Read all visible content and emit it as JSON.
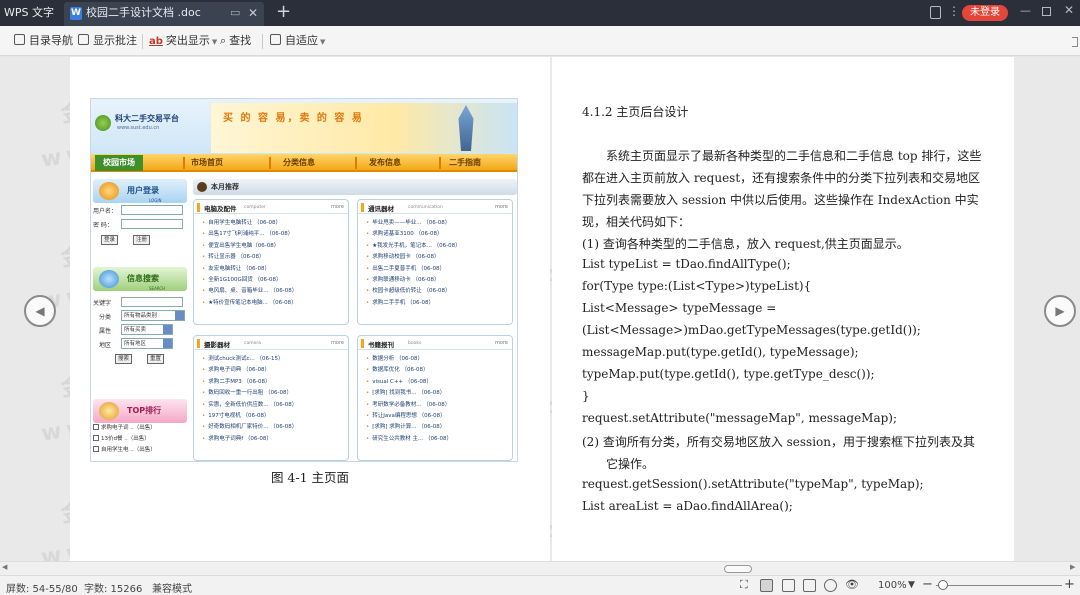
{
  "tabbar": {
    "app_name": "WPS 文字",
    "doc_tab": "校园二手设计文档 .doc",
    "login_label": "未登录"
  },
  "toolbar": {
    "outline_nav": "目录导航",
    "show_comments": "显示批注",
    "highlight": "突出显示",
    "find": "查找",
    "fit": "自适应"
  },
  "website": {
    "logo_name": "科大二手交易平台",
    "logo_url": "www.sust.edu.cn",
    "slogan": "买 的 容 易，卖 的 容 易",
    "nav_home": "校园市场",
    "nav_items": [
      "市场首页",
      "分类信息",
      "发布信息",
      "二手指南"
    ],
    "login_box": {
      "title": "用户登录",
      "sub": "LOGIN",
      "username_label": "用户名：",
      "password_label": "密 码：",
      "login_btn": "登录",
      "register_btn": "注册"
    },
    "search_box": {
      "title": "信息搜索",
      "sub": "SEARCH",
      "keyword_label": "关键字",
      "category_label": "分类",
      "category_value": "所有物品类别",
      "type_label": "属性",
      "type_value": "所有买卖",
      "area_label": "地区",
      "area_value": "所有地区",
      "search_btn": "搜索",
      "reset_btn": "重置"
    },
    "top_box": {
      "title": "TOP排行",
      "items": [
        "求购电子词 ..（出售）",
        "13价d餐 ..（出售）",
        "自用学生电 ..（出售）"
      ]
    },
    "recommend_title": "本月推荐",
    "categories": [
      {
        "name": "电脑及配件",
        "en": "computer",
        "more": "more",
        "items": [
          "自用学生电脑转让 （06-08）",
          "出售17寸飞利浦纯平... （06-08）",
          "便宜出售学生电脑（06-08）",
          "转让显示器 （06-08）",
          "友宏电脑转让 （06-08）",
          "全新1G100G回货 （06-08）",
          "电风扇、桌、音箱毕业... （06-08）",
          "★特价宣传笔记本电脑... （06-08）"
        ]
      },
      {
        "name": "通讯器材",
        "en": "communication",
        "more": "more",
        "items": [
          "毕业甩卖——毕业... （06-08）",
          "求购诺基亚3100 （06-08）",
          "★我发光手机，笔记本... （06-08）",
          "求购移动校园卡 （06-08）",
          "出售二手夏普手机 （06-08）",
          "求购联通移动卡 （06-08）",
          "校园卡超级低价转让 （06-08）",
          "求购二手手机 （06-08）"
        ]
      },
      {
        "name": "摄影器材",
        "en": "camera",
        "more": "more",
        "items": [
          "测试chuck测试c... （06-15）",
          "求购电子词典 （06-08）",
          "求购二手MP3 （06-08）",
          "数码回收一重一行出租 （06-08）",
          "实惠，全新低价供应数... （06-08）",
          "197寸电视机 （06-08）",
          "好奇数码相机厂家特价... （06-08）",
          "求购电子词典f （06-08）"
        ]
      },
      {
        "name": "书籍报刊",
        "en": "books",
        "more": "more",
        "items": [
          "数据分析 （06-08）",
          "数据库优化 （06-08）",
          "visual C++ （06-08）",
          "[求购] 找到我书... （06-08）",
          "考研数学必备教材... （06-08）",
          "转让Java编程思想 （06-08）",
          "[求购] 求购计算... （06-08）",
          "研究生公共教材 主... （06-08）"
        ]
      }
    ]
  },
  "figure_caption": "图 4-1 主页面",
  "right_page": {
    "section_title": "4.1.2  主页后台设计",
    "lines": [
      "系统主页面显示了最新各种类型的二手信息和二手信息 top 排行，这些",
      "都在进入主页前放入 request，还有搜索条件中的分类下拉列表和交易地区",
      "下拉列表需要放入 session 中供以后使用。这些操作在 IndexAction 中实",
      "现，相关代码如下：",
      "(1) 查询各种类型的二手信息，放入 request,供主页面显示。",
      "List typeList = tDao.findAllType();",
      "for(Type type:(List<Type>)typeList){",
      "List<Message> typeMessage =",
      "(List<Message>)mDao.getTypeMessages(type.getId());",
      "messageMap.put(type.getId(), typeMessage);",
      "typeMap.put(type.getId(), type.getType_desc());",
      "}",
      "request.setAttribute(\"messageMap\", messageMap);",
      "(2) 查询所有分类，所有交易地区放入 session，用于搜索框下拉列表及其",
      "它操作。",
      "request.getSession().setAttribute(\"typeMap\", typeMap);",
      "List areaList = aDao.findAllArea();"
    ]
  },
  "watermark": {
    "text": "金银的豆子网",
    "url": "www.jyddzi.com"
  },
  "statusbar": {
    "page_info": "屏数: 54-55/80",
    "word_count": "字数: 15266",
    "compat_mode": "兼容模式",
    "zoom": "100%",
    "zoom_minus": "−",
    "zoom_plus": "+"
  }
}
